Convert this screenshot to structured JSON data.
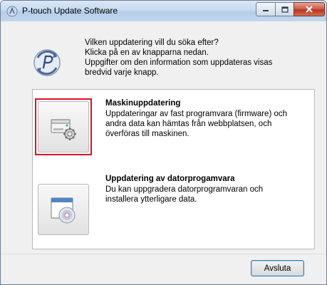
{
  "window": {
    "title": "P-touch Update Software"
  },
  "intro": {
    "lines": [
      "Vilken uppdatering vill du söka efter?",
      "Klicka på en av knapparna nedan.",
      "Uppgifter om den information som uppdateras visas",
      "bredvid varje knapp."
    ]
  },
  "options": [
    {
      "title": "Maskinuppdatering",
      "description": [
        "Uppdateringar av fast programvara (firmware) och",
        "andra data kan hämtas från webbplatsen, och",
        "överföras till maskinen."
      ],
      "icon": "printer-gear-icon",
      "highlighted": true
    },
    {
      "title": "Uppdatering av datorprogamvara",
      "description": [
        "Du kan uppgradera datorprogramvaran och",
        "installera ytterligare data."
      ],
      "icon": "window-cd-icon",
      "highlighted": false
    }
  ],
  "footer": {
    "quit_label": "Avsluta"
  },
  "colors": {
    "highlight": "#e0101e",
    "titlebar": "#c7dbf1",
    "close": "#c9553f"
  }
}
